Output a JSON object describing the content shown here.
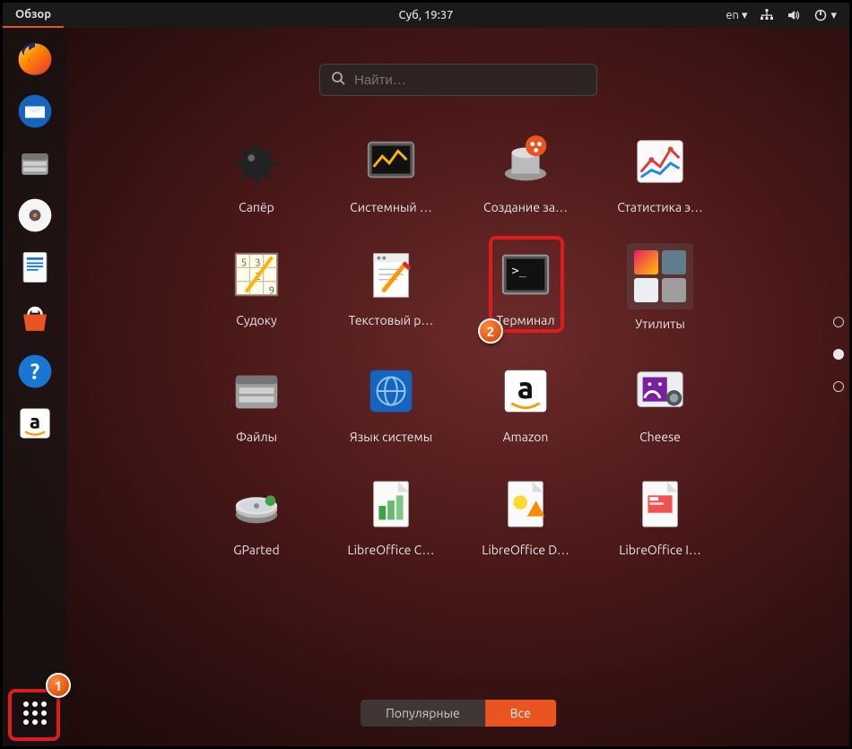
{
  "topbar": {
    "activities": "Обзор",
    "clock": "Суб, 19:37",
    "lang": "en",
    "lang_arrow": "▾",
    "power_arrow": "▾"
  },
  "dock": {
    "items": [
      {
        "name": "firefox"
      },
      {
        "name": "thunderbird"
      },
      {
        "name": "files"
      },
      {
        "name": "rhythmbox"
      },
      {
        "name": "libreoffice-writer"
      },
      {
        "name": "software"
      },
      {
        "name": "help"
      },
      {
        "name": "amazon"
      }
    ]
  },
  "search": {
    "placeholder": "Найти…"
  },
  "apps": [
    {
      "name": "mines",
      "label": "Сапёр"
    },
    {
      "name": "sysmon",
      "label": "Системный …"
    },
    {
      "name": "startup",
      "label": "Создание за…"
    },
    {
      "name": "powerstats",
      "label": "Статистика э…"
    },
    {
      "name": "sudoku",
      "label": "Судоку"
    },
    {
      "name": "gedit",
      "label": "Текстовый р…"
    },
    {
      "name": "terminal",
      "label": "Терминал"
    },
    {
      "name": "utilities",
      "label": "Утилиты",
      "folder": true
    },
    {
      "name": "files",
      "label": "Файлы"
    },
    {
      "name": "language",
      "label": "Язык системы"
    },
    {
      "name": "amazon",
      "label": "Amazon"
    },
    {
      "name": "cheese",
      "label": "Cheese"
    },
    {
      "name": "gparted",
      "label": "GParted"
    },
    {
      "name": "localc",
      "label": "LibreOffice C…"
    },
    {
      "name": "lodraw",
      "label": "LibreOffice D…"
    },
    {
      "name": "loimpress",
      "label": "LibreOffice I…"
    }
  ],
  "tabs": {
    "frequent": "Популярные",
    "all": "Все",
    "active": "all"
  },
  "markers": {
    "one": "1",
    "two": "2"
  },
  "colors": {
    "accent": "#E95420",
    "highlight": "#e01b1b"
  }
}
